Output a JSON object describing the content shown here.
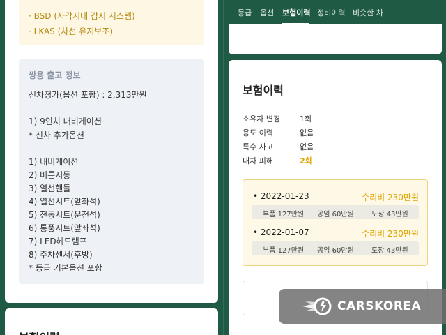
{
  "left": {
    "options": [
      "· BSD (사각지대 감지 시스템)",
      "· LKAS (차선 유지보조)"
    ],
    "info": {
      "title": "쌍용 출고 정보",
      "lines": [
        "신차정가(옵션 포함) : 2,313만원",
        "1) 9인치 내비게이션",
        "* 신차 추가옵션",
        "1) 내비게이션",
        "2) 버튼시동",
        "3) 열선핸들",
        "4) 열선시트(앞좌석)",
        "5) 전동시트(운전석)",
        "6) 통풍시트(앞좌석)",
        "7) LED헤드램프",
        "8) 주차센서(후방)",
        "* 등급 기본옵션 포함"
      ]
    },
    "next_title": "보험이력"
  },
  "right": {
    "tabs": [
      "등급",
      "옵션",
      "보험이력",
      "정비이력",
      "비슷한 차"
    ],
    "active_tab": "보험이력",
    "title": "보험이력",
    "stats": [
      {
        "label": "소유자 변경",
        "value": "1회"
      },
      {
        "label": "용도 이력",
        "value": "없음"
      },
      {
        "label": "특수 사고",
        "value": "없음"
      },
      {
        "label": "내차 피해",
        "value": "2회"
      }
    ],
    "claims": [
      {
        "date": "• 2022-01-23",
        "cost": "수리비 230만원",
        "parts": "부품 127만원",
        "labor": "공임 60만원",
        "paint": "도장 43만원"
      },
      {
        "date": "• 2022-01-07",
        "cost": "수리비 230만원",
        "parts": "부품 127만원",
        "labor": "공임 60만원",
        "paint": "도장 43만원"
      }
    ]
  },
  "watermark": {
    "text": "CARSKOREA"
  },
  "colors": {
    "brand_green": "#1f5a44",
    "accent_gold": "#e0a400"
  }
}
